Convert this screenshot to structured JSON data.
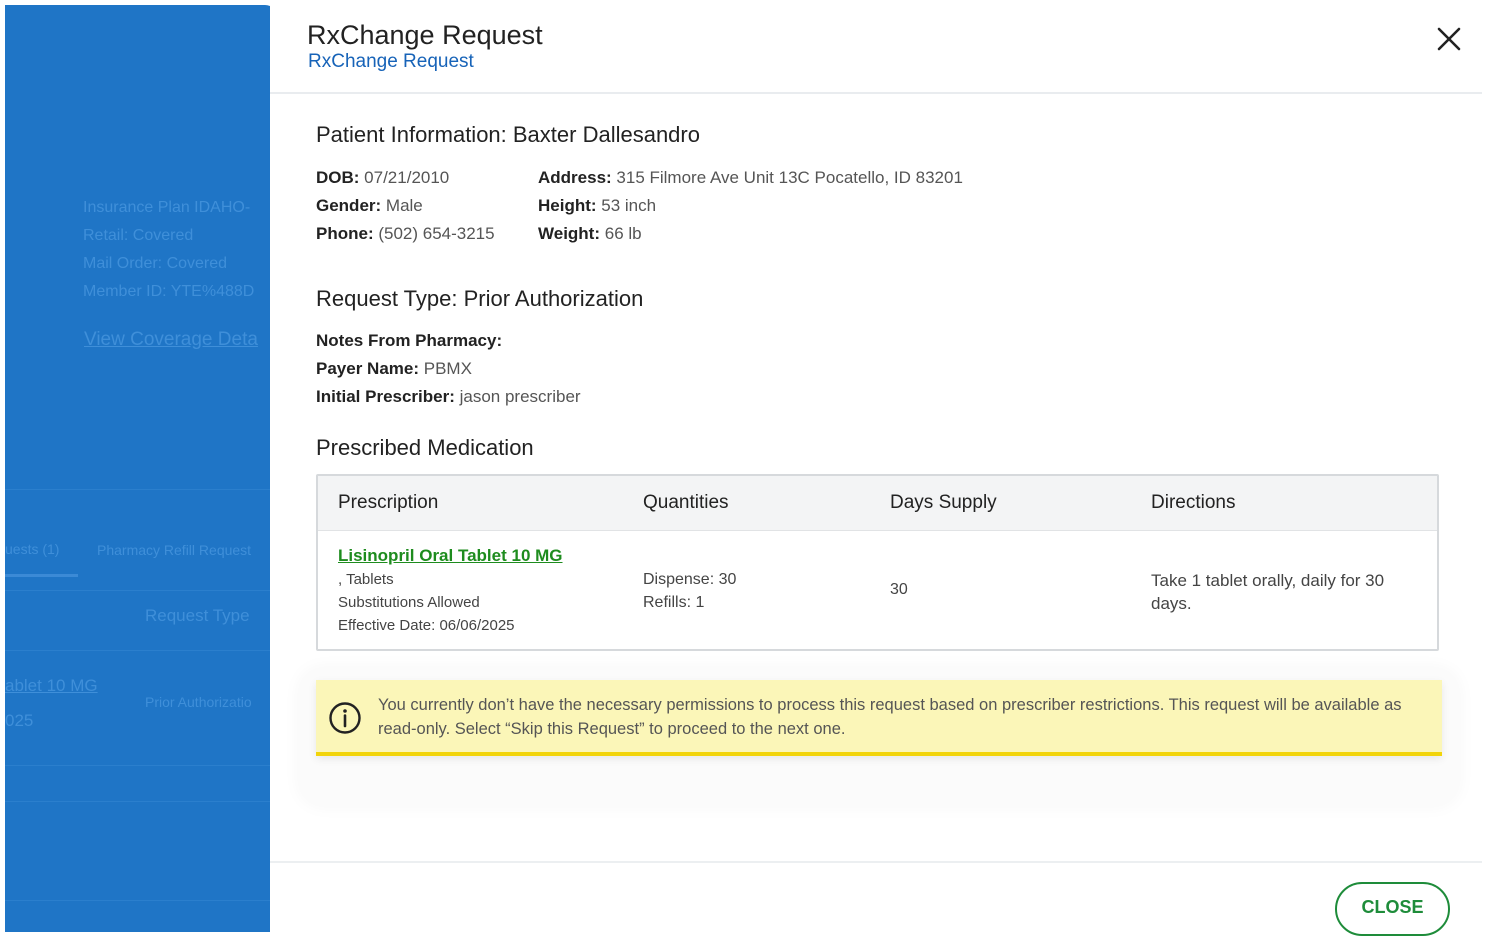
{
  "background": {
    "insurance_plan": "Insurance Plan IDAHO-",
    "retail": "Retail: Covered",
    "mail_order": "Mail Order: Covered",
    "member_id": "Member ID: YTE%488D",
    "coverage_link": "View Coverage Deta",
    "tab_requests": "uests (1)",
    "tab_refill": "Pharmacy Refill Request",
    "col_request_type": "Request Type",
    "row_drug": "ablet 10 MG",
    "row_date": "025",
    "row_type": "Prior Authorizatio"
  },
  "modal": {
    "title": "RxChange Request",
    "subtitle": "RxChange Request",
    "close_icon": "close-icon"
  },
  "patient": {
    "heading": "Patient Information: Baxter Dallesandro",
    "dob_label": "DOB:",
    "dob": " 07/21/2010",
    "gender_label": "Gender:",
    "gender": " Male",
    "phone_label": "Phone:",
    "phone": " (502) 654-3215",
    "address_label": "Address:",
    "address": " 315 Filmore Ave Unit 13C Pocatello, ID 83201",
    "height_label": "Height:",
    "height": " 53 inch",
    "weight_label": "Weight:",
    "weight": " 66 lb"
  },
  "request": {
    "heading": "Request Type: Prior Authorization",
    "notes_label": "Notes From Pharmacy:",
    "payer_label": "Payer Name:",
    "payer": " PBMX",
    "prescriber_label": "Initial Prescriber:",
    "prescriber": " jason prescriber"
  },
  "medication": {
    "heading": "Prescribed Medication",
    "columns": [
      "Prescription",
      "Quantities",
      "Days Supply",
      "Directions"
    ],
    "drug_name": "Lisinopril Oral Tablet 10 MG",
    "form": ", Tablets",
    "substitutions": "Substitutions Allowed",
    "effective": "Effective Date: 06/06/2025",
    "dispense": "Dispense: 30",
    "refills": "Refills: 1",
    "days_supply": "30",
    "directions": "Take 1 tablet orally, daily for 30 days."
  },
  "alert": {
    "icon": "info-icon",
    "text": "You currently don’t have the necessary permissions to process this request based on prescriber restrictions. This request will be available as read-only. Select “Skip this Request” to proceed to the next one."
  },
  "footer": {
    "close_label": "CLOSE"
  },
  "colors": {
    "backdrop": "#1f75c6",
    "link_blue": "#1763b8",
    "accent_green": "#1e8c3a",
    "alert_bg": "#fbf6b8",
    "alert_border": "#f2d40a"
  }
}
